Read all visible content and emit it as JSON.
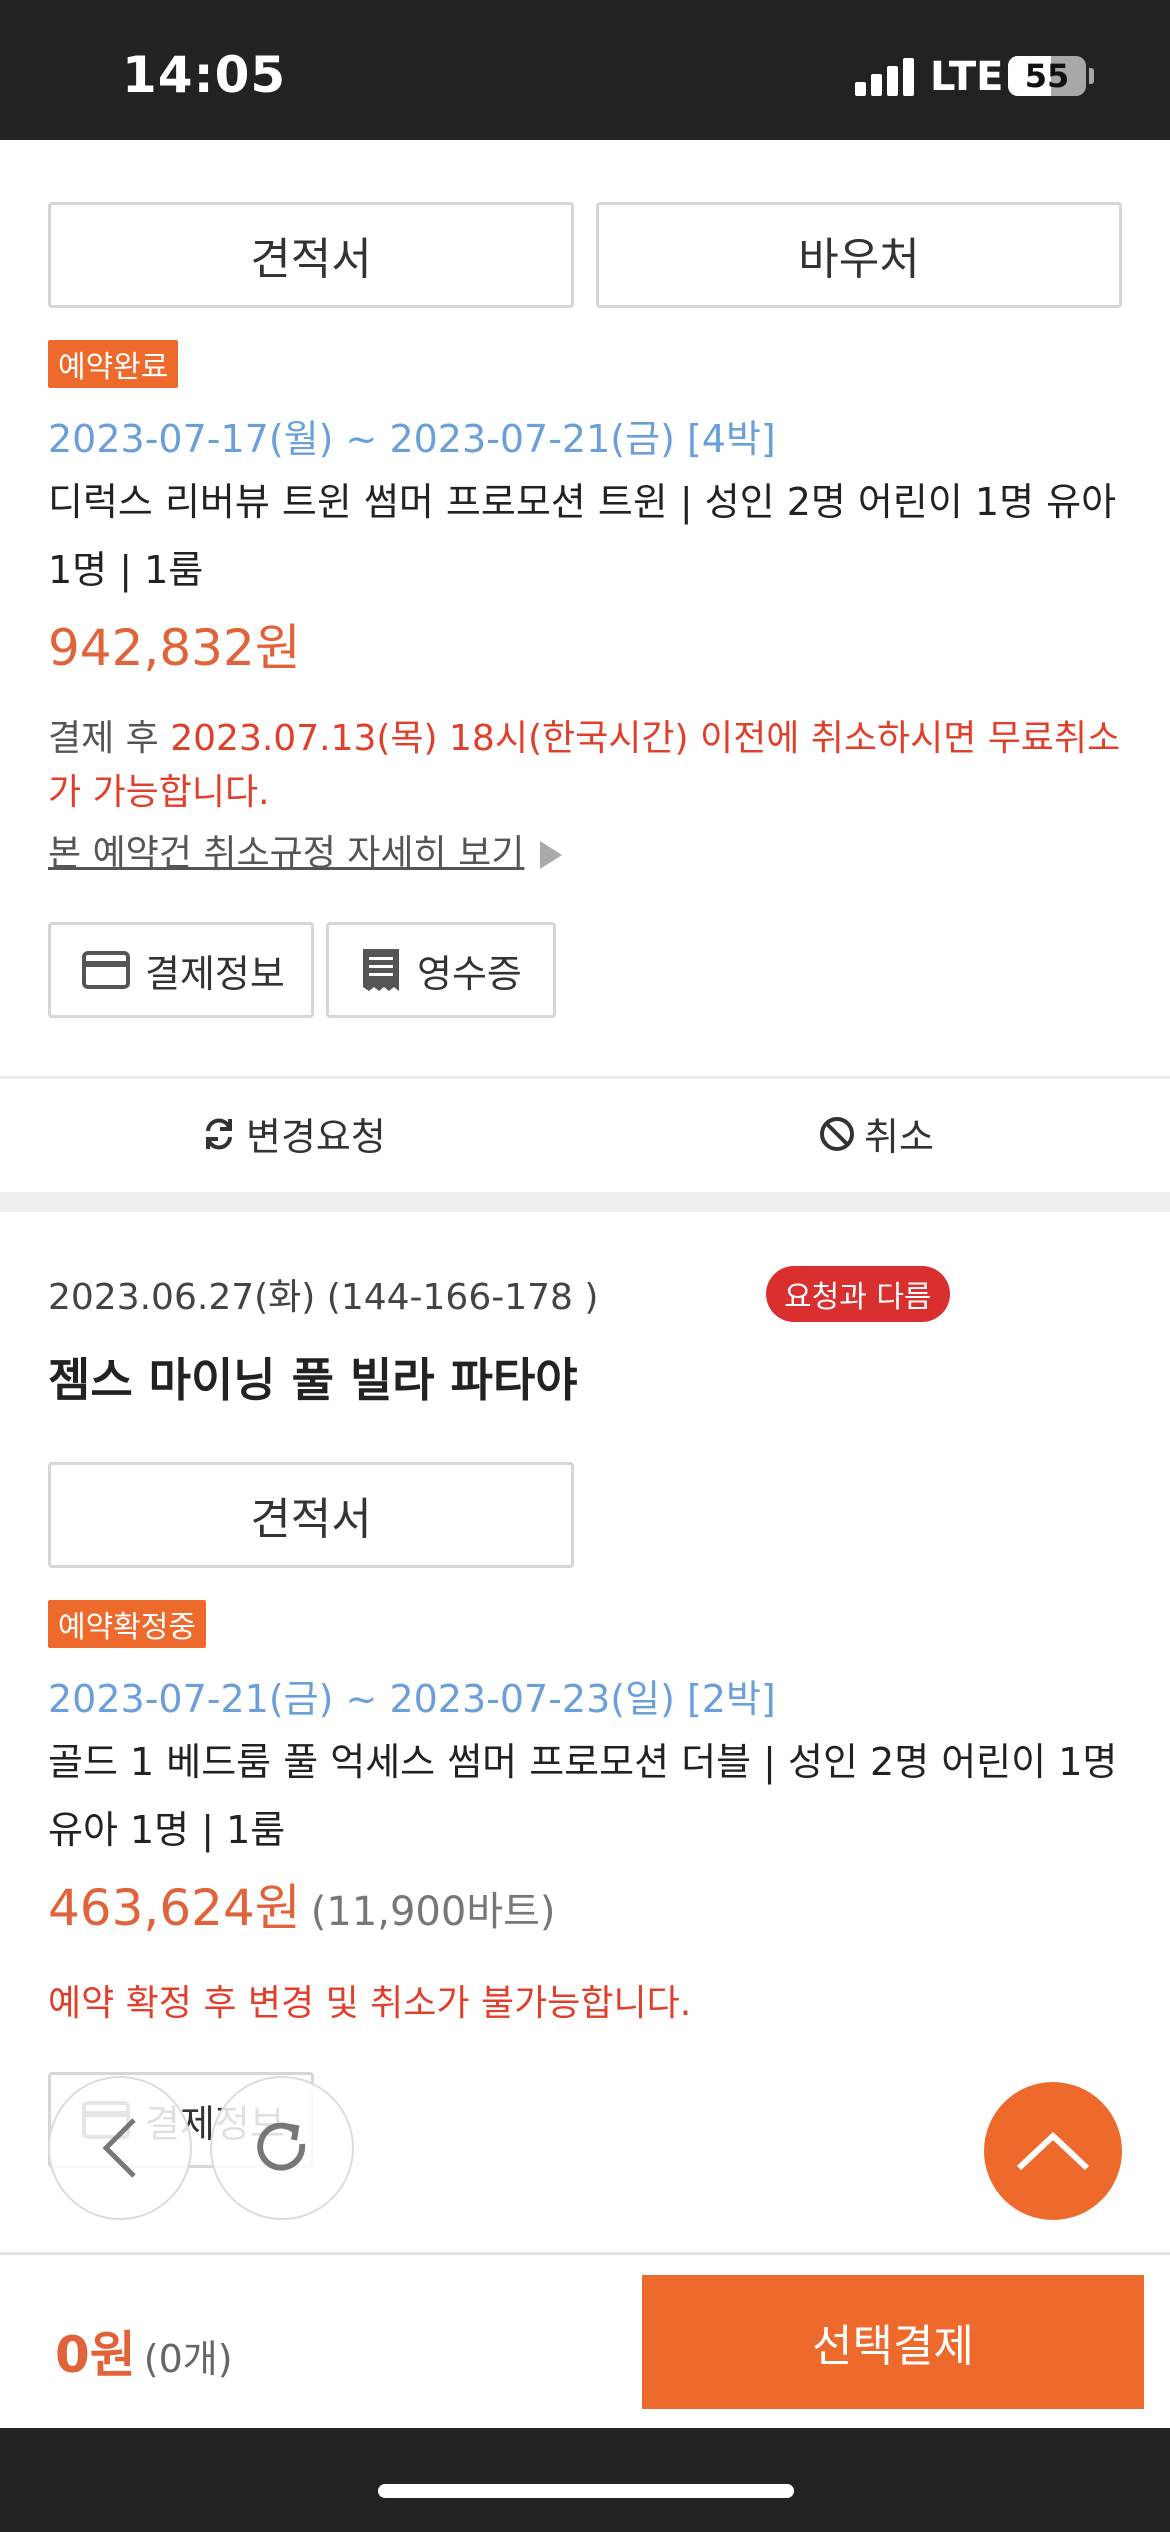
{
  "status_bar": {
    "time": "14:05",
    "network": "LTE",
    "battery": "55"
  },
  "booking1": {
    "quote_label": "견적서",
    "voucher_label": "바우처",
    "status_badge": "예약완료",
    "dates": "2023-07-17(월) ~ 2023-07-21(금) [4박]",
    "room_desc": "디럭스 리버뷰 트윈 썸머 프로모션 트윈 | 성인 2명 어린이 1명 유아 1명 | 1룸",
    "price": "942,832원",
    "notice_prefix": "결제 후 ",
    "notice_highlight": "2023.07.13(목) 18시(한국시간) 이전에 취소하시면 무료취소가 가능합니다.",
    "policy_link": "본 예약건 취소규정 자세히 보기",
    "payment_info_label": "결제정보",
    "receipt_label": "영수증",
    "change_request_label": "변경요청",
    "cancel_label": "취소"
  },
  "booking2": {
    "booking_date": "2023.06.27(화) (144-166-178 )",
    "diff_badge": "요청과 다름",
    "hotel_name": "젬스 마이닝 풀 빌라 파타야",
    "quote_label": "견적서",
    "status_badge": "예약확정중",
    "dates": "2023-07-21(금) ~ 2023-07-23(일) [2박]",
    "room_desc": "골드 1 베드룸 풀 억세스 썸머 프로모션 더블 | 성인 2명 어린이 1명 유아 1명 | 1룸",
    "price": "463,624원",
    "price_sub": "(11,900바트)",
    "notice": "예약 확정 후 변경 및 취소가 불가능합니다.",
    "payment_info_label": "결제정보"
  },
  "bottom_bar": {
    "total": "0원",
    "count": "(0개)",
    "pay_label": "선택결제"
  },
  "colors": {
    "accent": "#ee6a2c",
    "price": "#e0633a",
    "date": "#6b9fd9",
    "alert": "#e0402b",
    "badge_diff": "#d92f2f"
  },
  "icons": [
    "card-icon",
    "receipt-icon",
    "refresh-icon",
    "block-icon",
    "back-arrow-icon",
    "reload-icon",
    "chevron-up-icon"
  ]
}
